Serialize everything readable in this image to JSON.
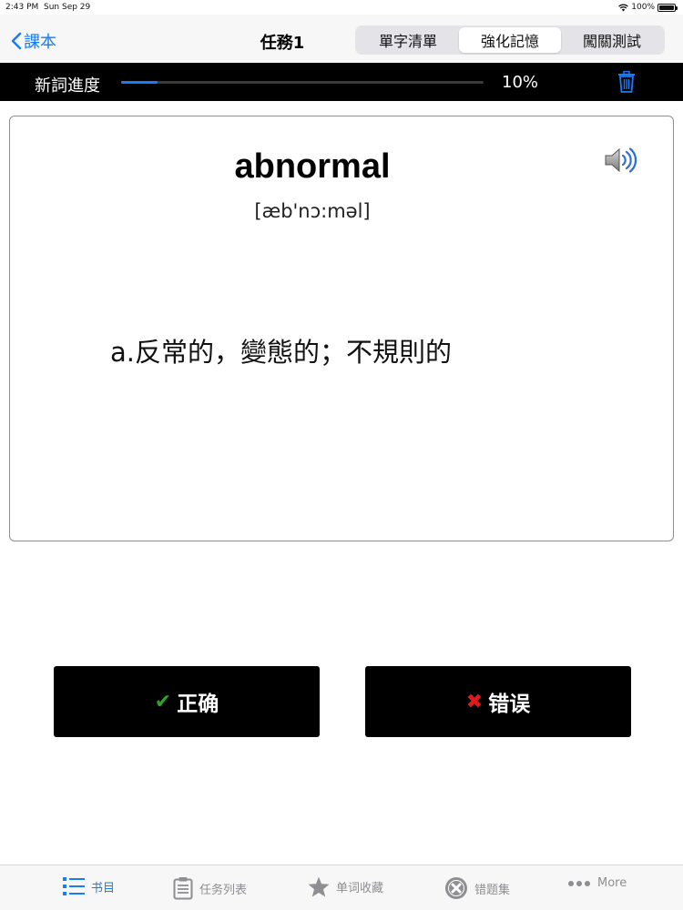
{
  "status": {
    "time": "2:43 PM",
    "date": "Sun Sep 29",
    "battery": "100%"
  },
  "nav": {
    "back_label": "課本",
    "title": "任務1",
    "segments": [
      "單字清單",
      "強化記憶",
      "闖關測試"
    ],
    "active_segment": 1
  },
  "progress": {
    "label": "新詞進度",
    "percent_text": "10%",
    "value": 0.1
  },
  "card": {
    "word": "abnormal",
    "phonetic": "[æb'nɔ:məl]",
    "definition": "a.反常的，變態的；不規則的"
  },
  "answers": {
    "correct_label": "正确",
    "wrong_label": "错误"
  },
  "tabs": [
    {
      "label": "书目",
      "icon": "list-icon"
    },
    {
      "label": "任务列表",
      "icon": "clipboard-icon"
    },
    {
      "label": "单词收藏",
      "icon": "star-icon"
    },
    {
      "label": "错题集",
      "icon": "x-circle-icon"
    },
    {
      "label": "More",
      "icon": "more-icon"
    }
  ],
  "colors": {
    "accent": "#1a7cf5",
    "correct": "#32a02c",
    "wrong": "#e01a1a"
  }
}
